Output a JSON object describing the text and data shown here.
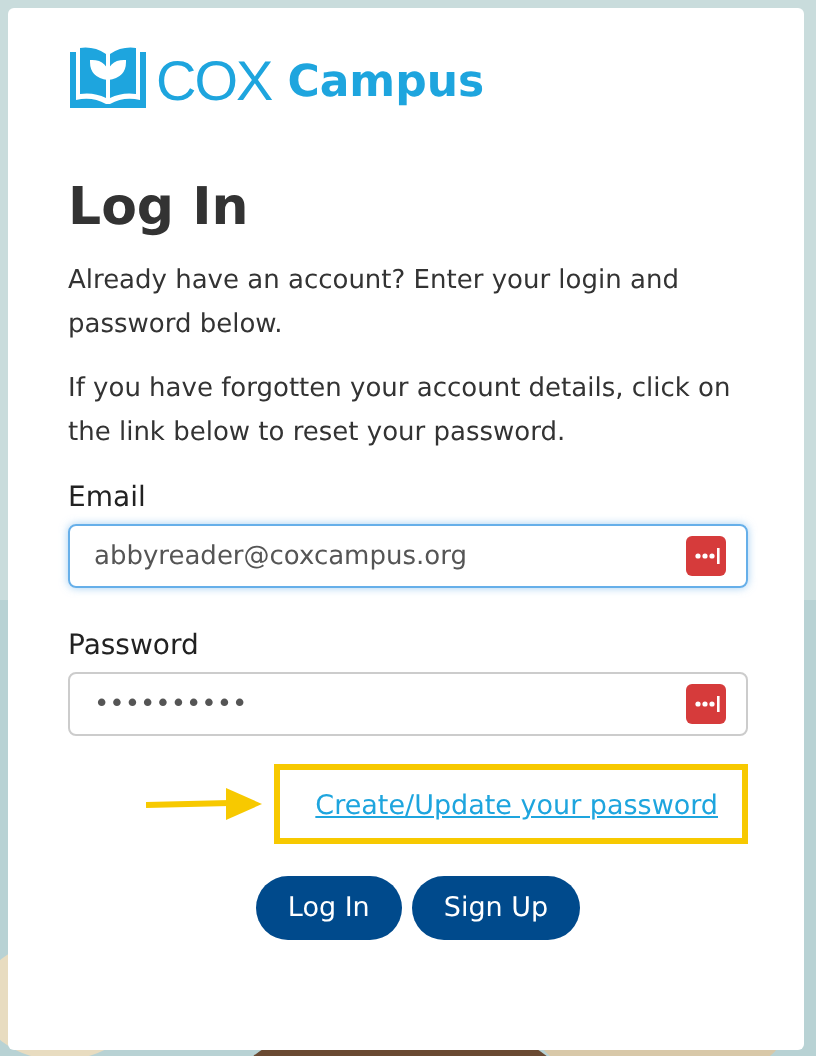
{
  "logo": {
    "brand": "COX",
    "product": "Campus"
  },
  "title": "Log In",
  "paragraphs": [
    "Already have an account? Enter your login and password below.",
    "If you have forgotten your account details, click on the link below to reset your password."
  ],
  "fields": [
    {
      "label": "Email",
      "value": "abbyreader@coxcampus.org",
      "focused": true
    },
    {
      "label": "Password",
      "value": "••••••••••",
      "focused": false
    }
  ],
  "reset_link": {
    "label": "Create/Update your password",
    "highlighted": true
  },
  "buttons": [
    "Log In",
    "Sign Up"
  ]
}
